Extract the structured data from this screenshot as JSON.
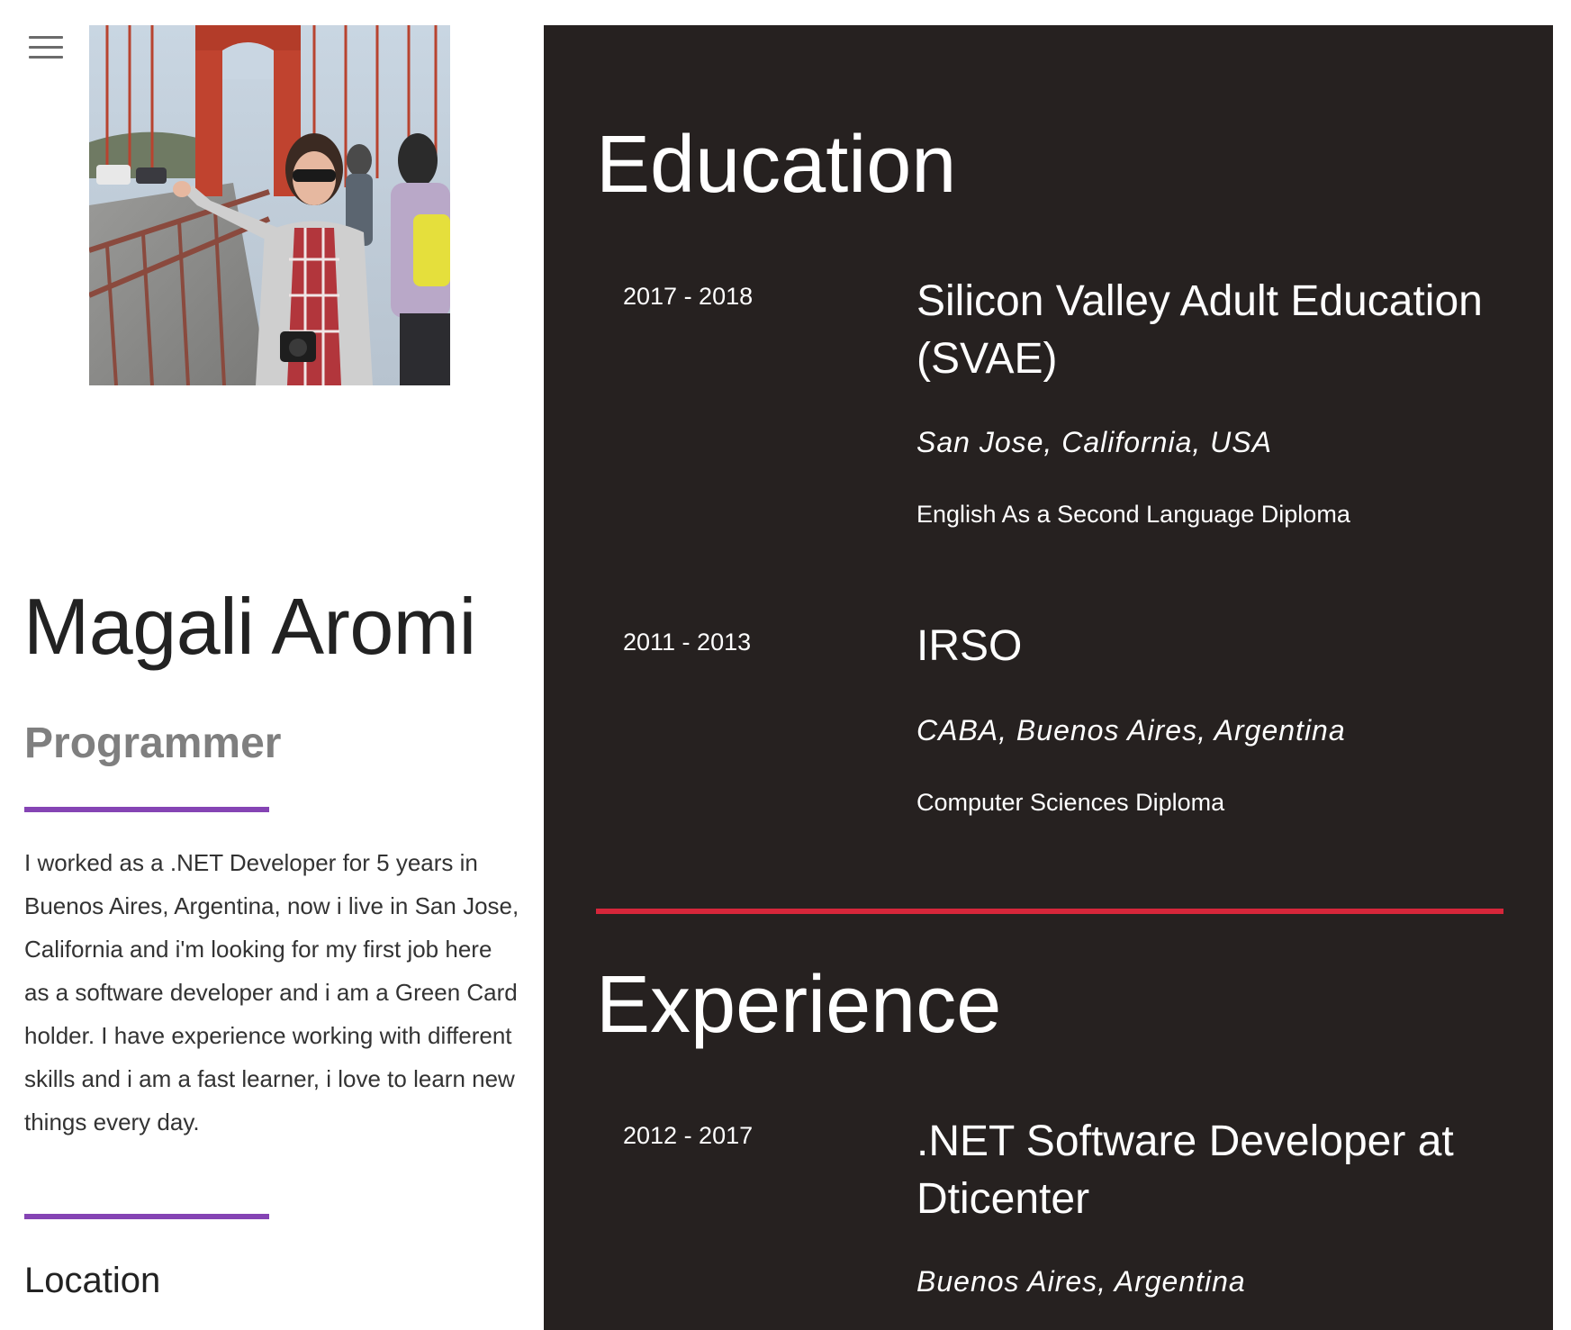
{
  "sidebar": {
    "menu_icon": "hamburger-menu-icon",
    "photo_alt": "Profile photo on Golden Gate Bridge",
    "name": "Magali Aromi",
    "role": "Programmer",
    "bio": "I worked as a .NET Developer for 5 years in Buenos Aires, Argentina, now i live in San Jose, California and i'm looking for my first job here as a software developer and i am a Green Card holder. I have experience working with different skills and i am a fast learner, i love to learn new things every day.",
    "location_heading": "Location",
    "accent_color": "#8544b4"
  },
  "education": {
    "heading": "Education",
    "entries": [
      {
        "dates": "2017 - 2018",
        "title": "Silicon Valley Adult Education (SVAE)",
        "place": "San Jose, California, USA",
        "description": "English As a Second Language Diploma"
      },
      {
        "dates": "2011 - 2013",
        "title": "IRSO",
        "place": "CABA, Buenos Aires, Argentina",
        "description": "Computer Sciences Diploma"
      }
    ]
  },
  "experience": {
    "heading": "Experience",
    "entries": [
      {
        "dates": "2012 - 2017",
        "title": ".NET Software Developer at Dticenter",
        "place": "Buenos Aires, Argentina"
      }
    ]
  },
  "colors": {
    "panel_background": "#262120",
    "section_divider": "#d6263a"
  }
}
